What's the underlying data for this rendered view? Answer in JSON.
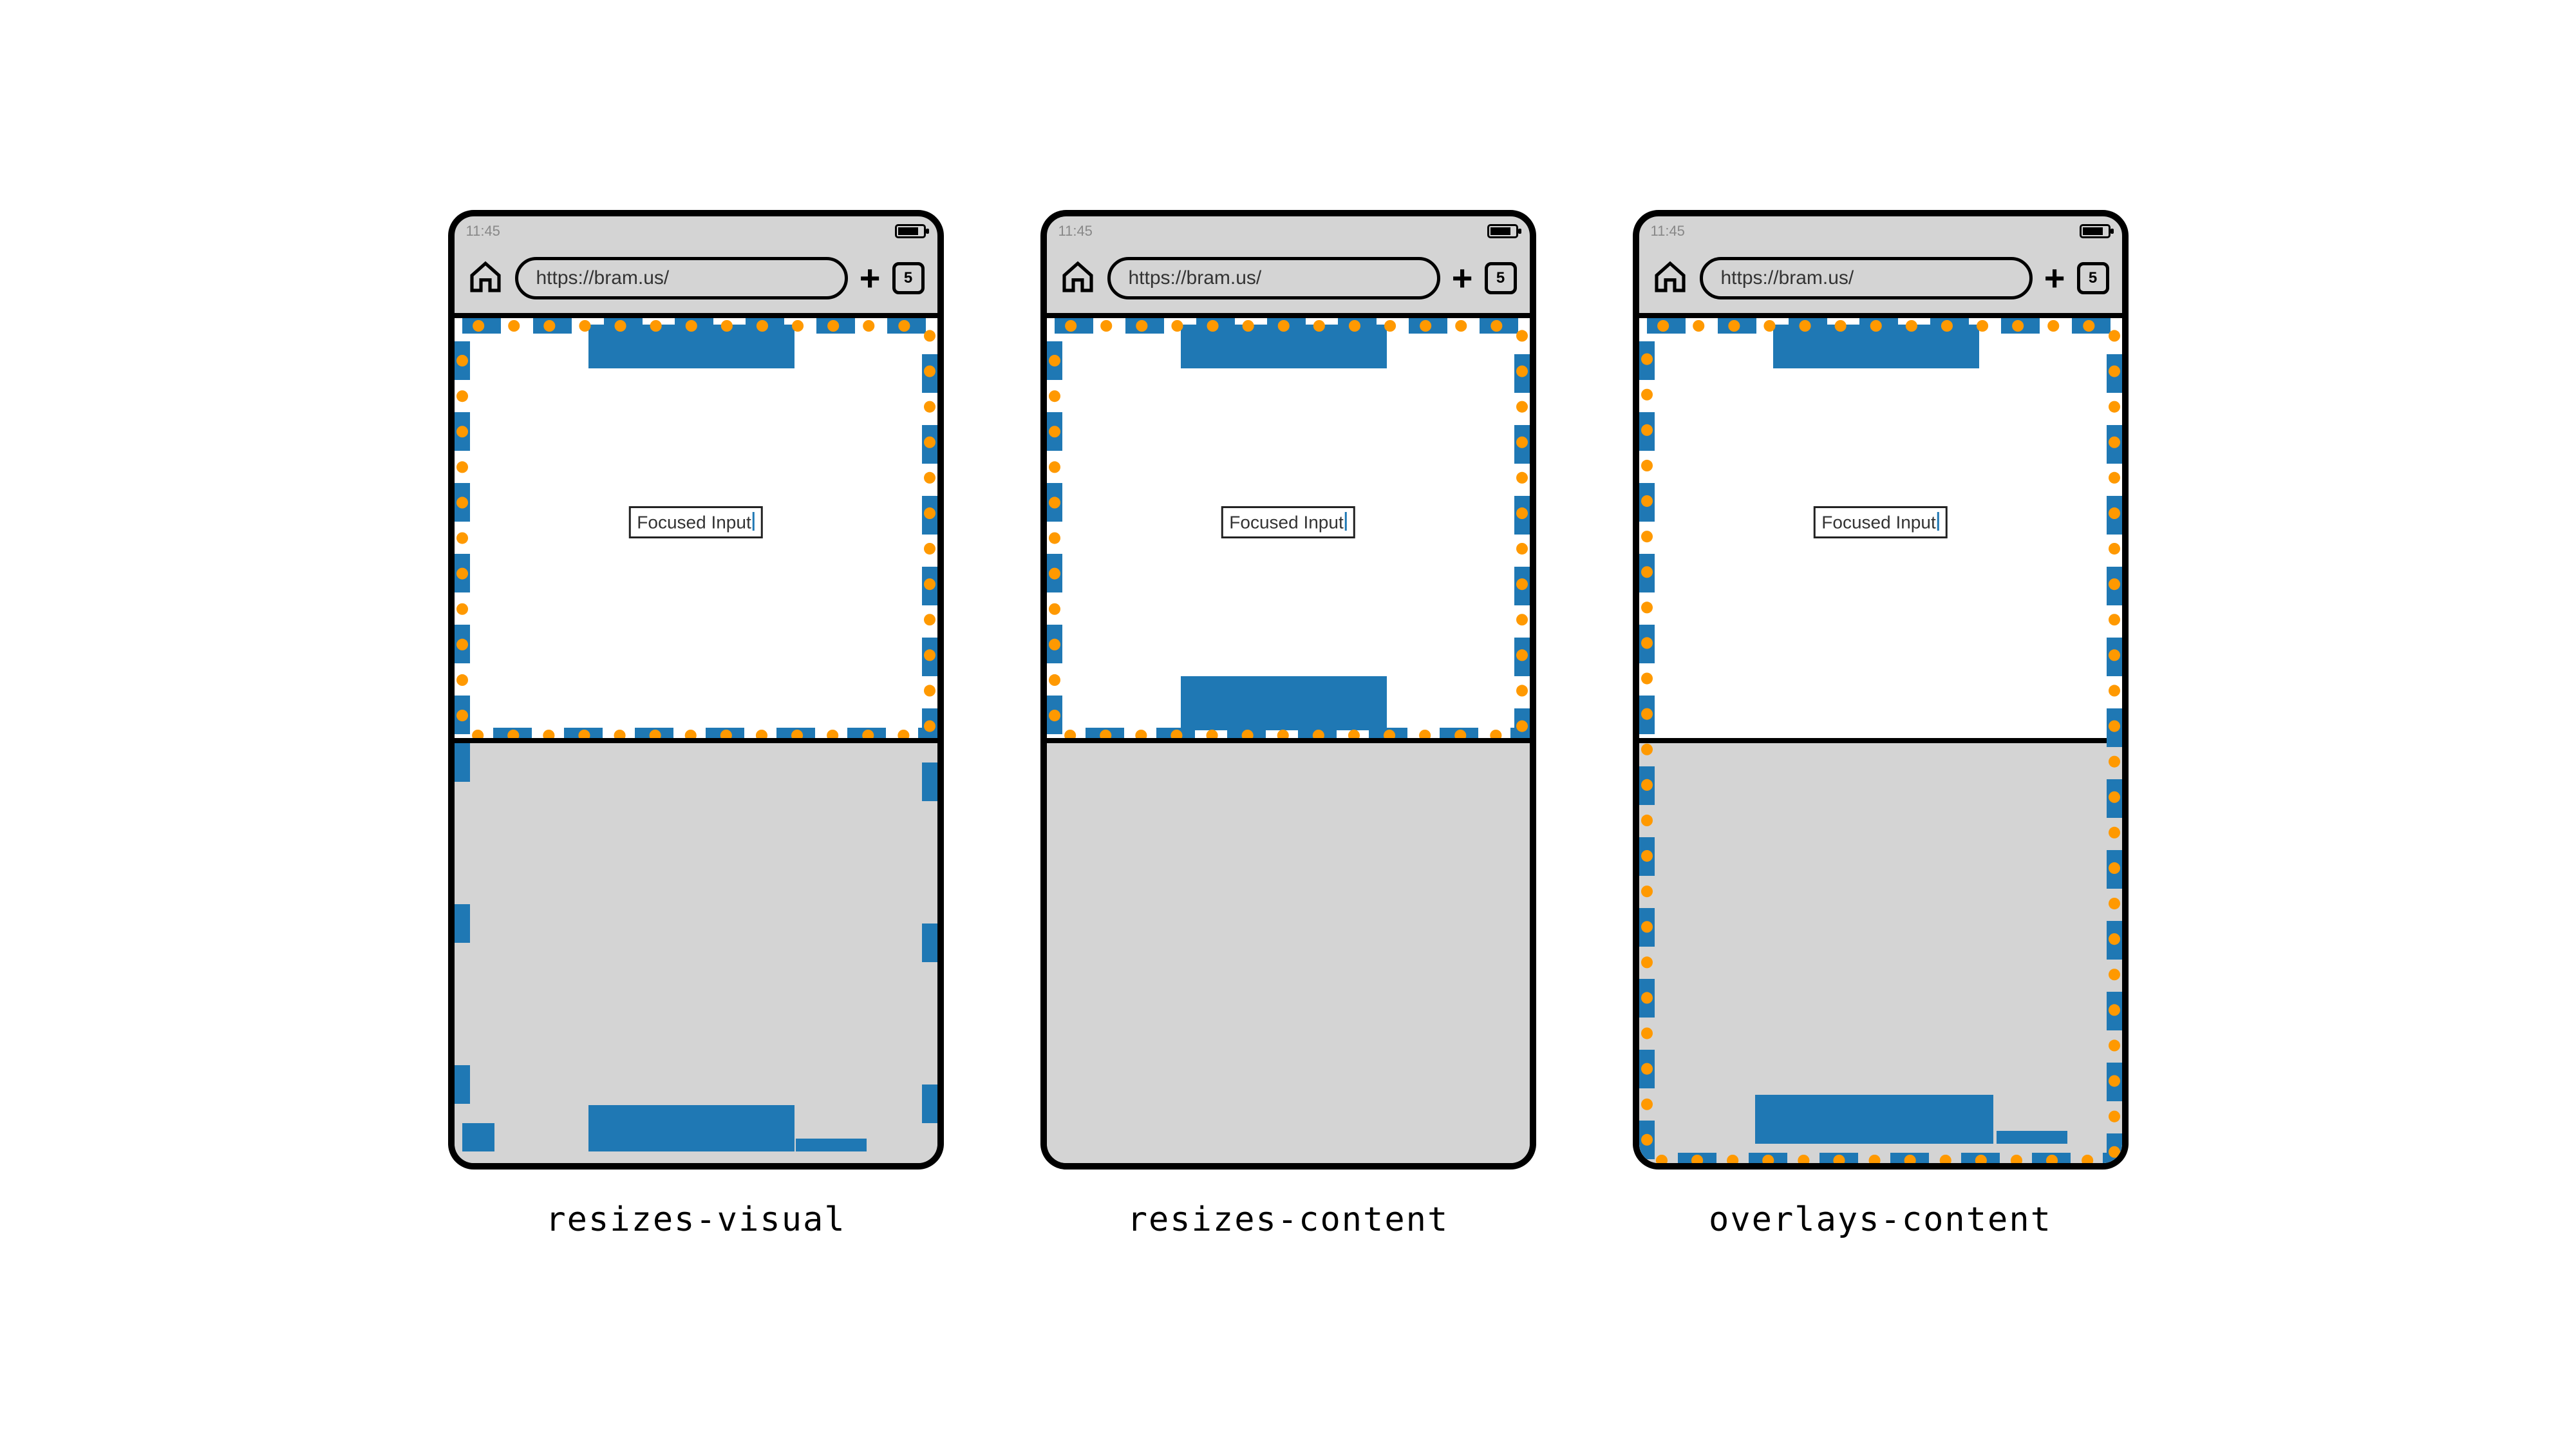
{
  "status_time": "11:45",
  "url": "https://bram.us/",
  "tab_count": "5",
  "focused_input_text": "Focused Input",
  "captions": {
    "a": "resizes-visual",
    "b": "resizes-content",
    "c": "overlays-content"
  },
  "colors": {
    "blue": "#1f78b4",
    "orange": "#ff9900",
    "grey": "#d4d4d4"
  }
}
